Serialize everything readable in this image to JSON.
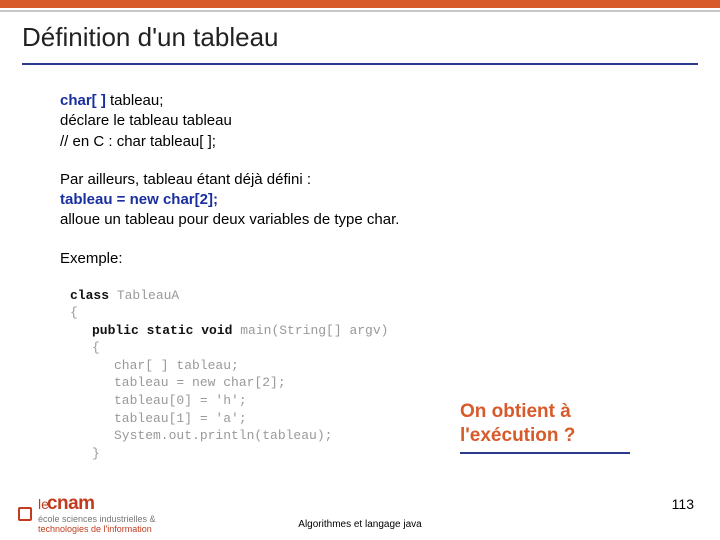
{
  "title": "Définition d'un tableau",
  "block1": {
    "line1_kw": "char[ ]",
    "line1_rest": " tableau;",
    "line2": "déclare le tableau tableau",
    "line3": " // en C : char tableau[ ];"
  },
  "block2": {
    "line1": "Par ailleurs, tableau étant déjà défini :",
    "line2_kw": "tableau = new char[2];",
    "line3": "alloue un tableau pour deux variables de type char."
  },
  "block3": {
    "label": "Exemple:"
  },
  "code": {
    "kw_class": "class",
    "c1": " TableauA",
    "brace_open": "{",
    "kw_public": "public static void",
    "c_main": " main(String[] argv)",
    "brace_open2": "{",
    "l_decl": "char[ ] tableau;",
    "l_new": "tableau = new char[2];",
    "l_a0": "tableau[0] = 'h';",
    "l_a1": "tableau[1] = 'a';",
    "l_print": "System.out.println(tableau);",
    "brace_close": "}"
  },
  "callout": {
    "l1": "On obtient à",
    "l2": "l'exécution ?"
  },
  "footer": {
    "center": "Algorithmes et langage java",
    "page": "113",
    "logo_le": "le",
    "logo_cnam": "cnam",
    "logo_sub1": "école sciences industrielles &",
    "logo_sub2": "technologies de l'information"
  }
}
